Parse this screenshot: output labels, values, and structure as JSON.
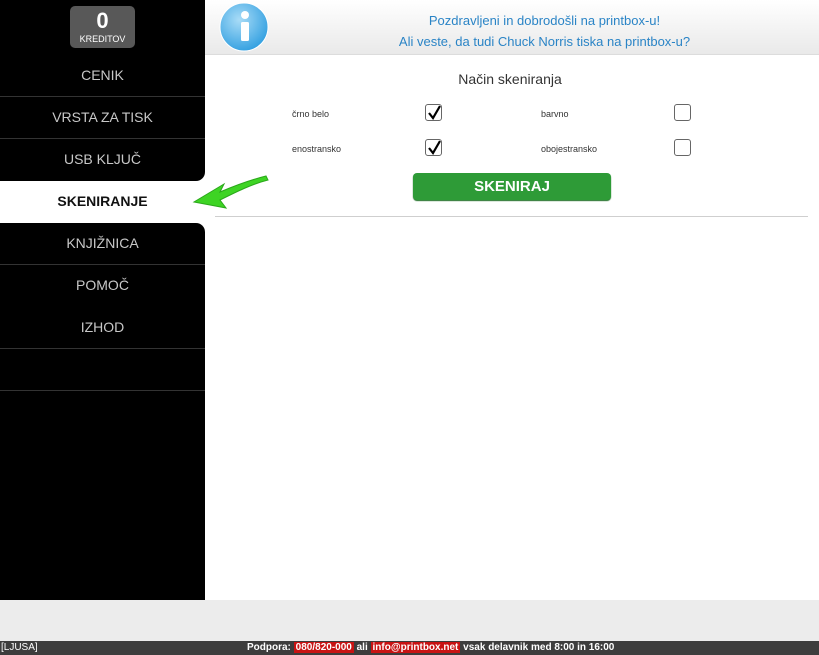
{
  "credits": {
    "value": "0",
    "label": "KREDITOV"
  },
  "nav": {
    "items": [
      "CENIK",
      "VRSTA ZA TISK",
      "USB KLJUČ",
      "SKENIRANJE",
      "KNJIŽNICA",
      "POMOČ",
      "IZHOD"
    ],
    "active": "SKENIRANJE"
  },
  "header": {
    "line1": "Pozdravljeni in dobrodošli na printbox-u!",
    "line2": "Ali veste, da tudi Chuck Norris tiska na printbox-u?"
  },
  "scan": {
    "title": "Način skeniranja",
    "options": [
      {
        "label": "črno belo",
        "checked": true
      },
      {
        "label": "barvno",
        "checked": false
      },
      {
        "label": "enostransko",
        "checked": true
      },
      {
        "label": "obojestransko",
        "checked": false
      }
    ],
    "button": "SKENIRAJ"
  },
  "footer": {
    "location": "[LJUSA]",
    "support_label": "Podpora:",
    "phone": "080/820-000",
    "or": "ali",
    "email": "info@printbox.net",
    "hours": "vsak delavnik med 8:00 in 16:00"
  },
  "colors": {
    "accent_green": "#2e9b37",
    "link_blue": "#2a84c6",
    "footer_red": "#c81313"
  }
}
